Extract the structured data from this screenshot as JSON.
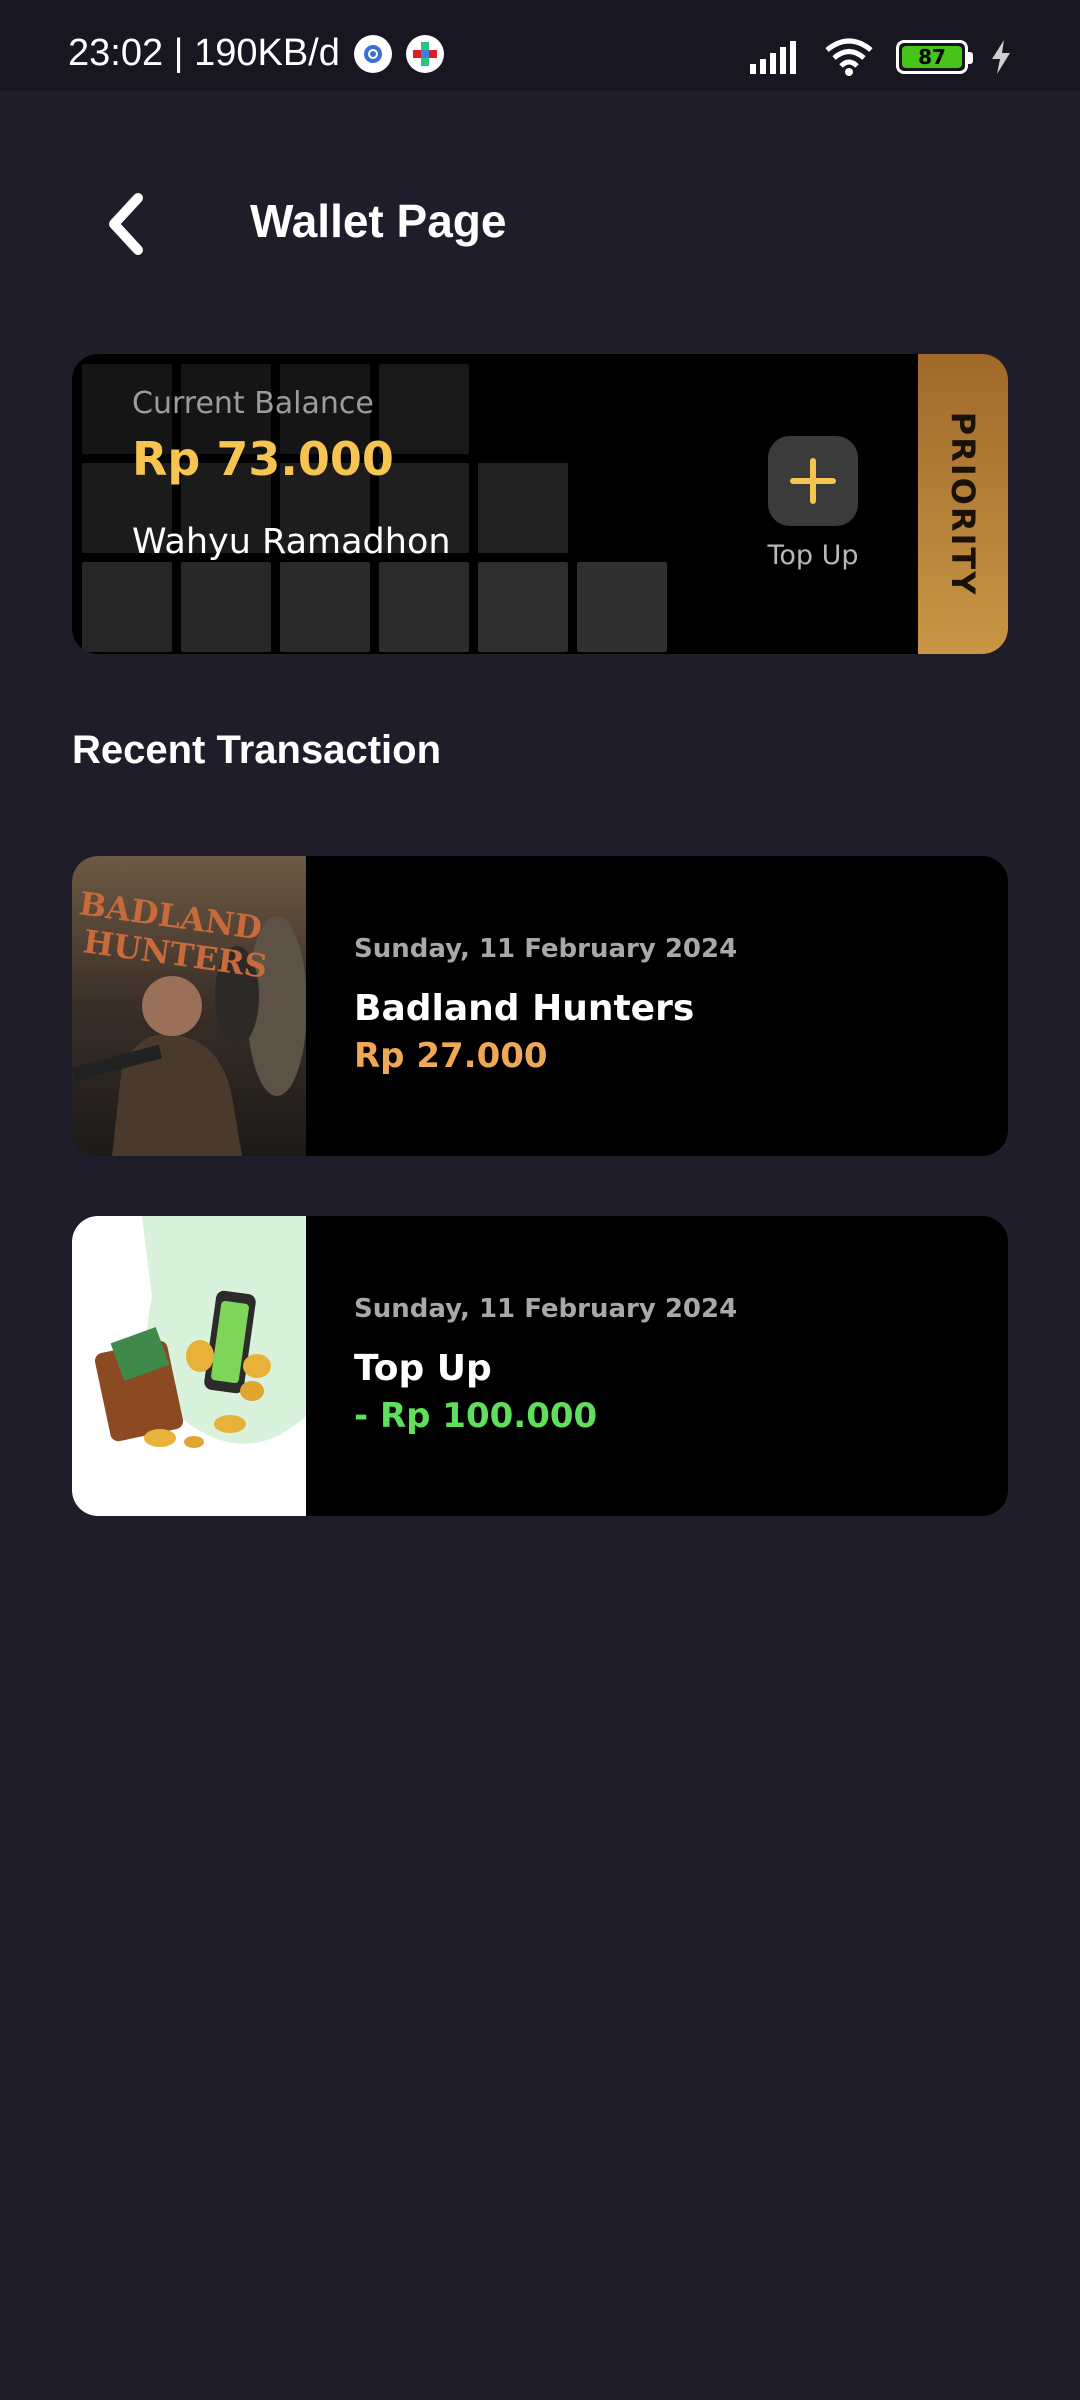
{
  "status_bar": {
    "time_speed": "23:02 | 190KB/d",
    "battery": "87"
  },
  "header": {
    "title": "Wallet Page"
  },
  "balance_card": {
    "label": "Current Balance",
    "amount": "Rp 73.000",
    "name": "Wahyu Ramadhon",
    "topup_label": "Top Up",
    "badge": "PRIORITY"
  },
  "section": {
    "title": "Recent Transaction"
  },
  "transactions": [
    {
      "date": "Sunday, 11 February 2024",
      "title": "Badland Hunters",
      "amount": "Rp 27.000",
      "amount_color": "#f0a857",
      "poster_text_1": "BADLAND",
      "poster_text_2": "HUNTERS"
    },
    {
      "date": "Sunday, 11 February 2024",
      "title": "Top Up",
      "amount": "- Rp 100.000",
      "amount_color": "#5fe05b"
    }
  ],
  "colors": {
    "background": "#1f1d2a",
    "card": "#000000",
    "accent_gold": "#f5c451"
  }
}
